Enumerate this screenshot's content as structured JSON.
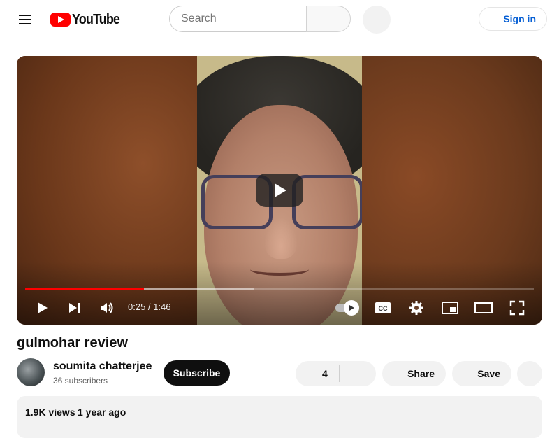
{
  "header": {
    "logo_text": "YouTube",
    "search_placeholder": "Search",
    "signin_label": "Sign in"
  },
  "player": {
    "current_time": "0:25",
    "duration": "1:46",
    "time_display": "0:25 / 1:46",
    "played_fraction": 0.233,
    "buffered_fraction": 0.451,
    "accent_color": "#ff0000",
    "icons": [
      "play-icon",
      "next-icon",
      "volume-icon",
      "autoplay-toggle",
      "subtitles-icon",
      "settings-icon",
      "miniplayer-icon",
      "theater-icon",
      "fullscreen-icon"
    ]
  },
  "video": {
    "title": "gulmohar review"
  },
  "channel": {
    "name": "soumita chatterjee",
    "subscribers": "36 subscribers",
    "subscribe_label": "Subscribe"
  },
  "actions": {
    "like_count": "4",
    "share_label": "Share",
    "save_label": "Save"
  },
  "description": {
    "views": "1.9K views",
    "date": "1 year ago"
  },
  "colors": {
    "brand_red": "#ff0000",
    "link_blue": "#065fd4",
    "pill_gray": "#f2f2f2"
  }
}
